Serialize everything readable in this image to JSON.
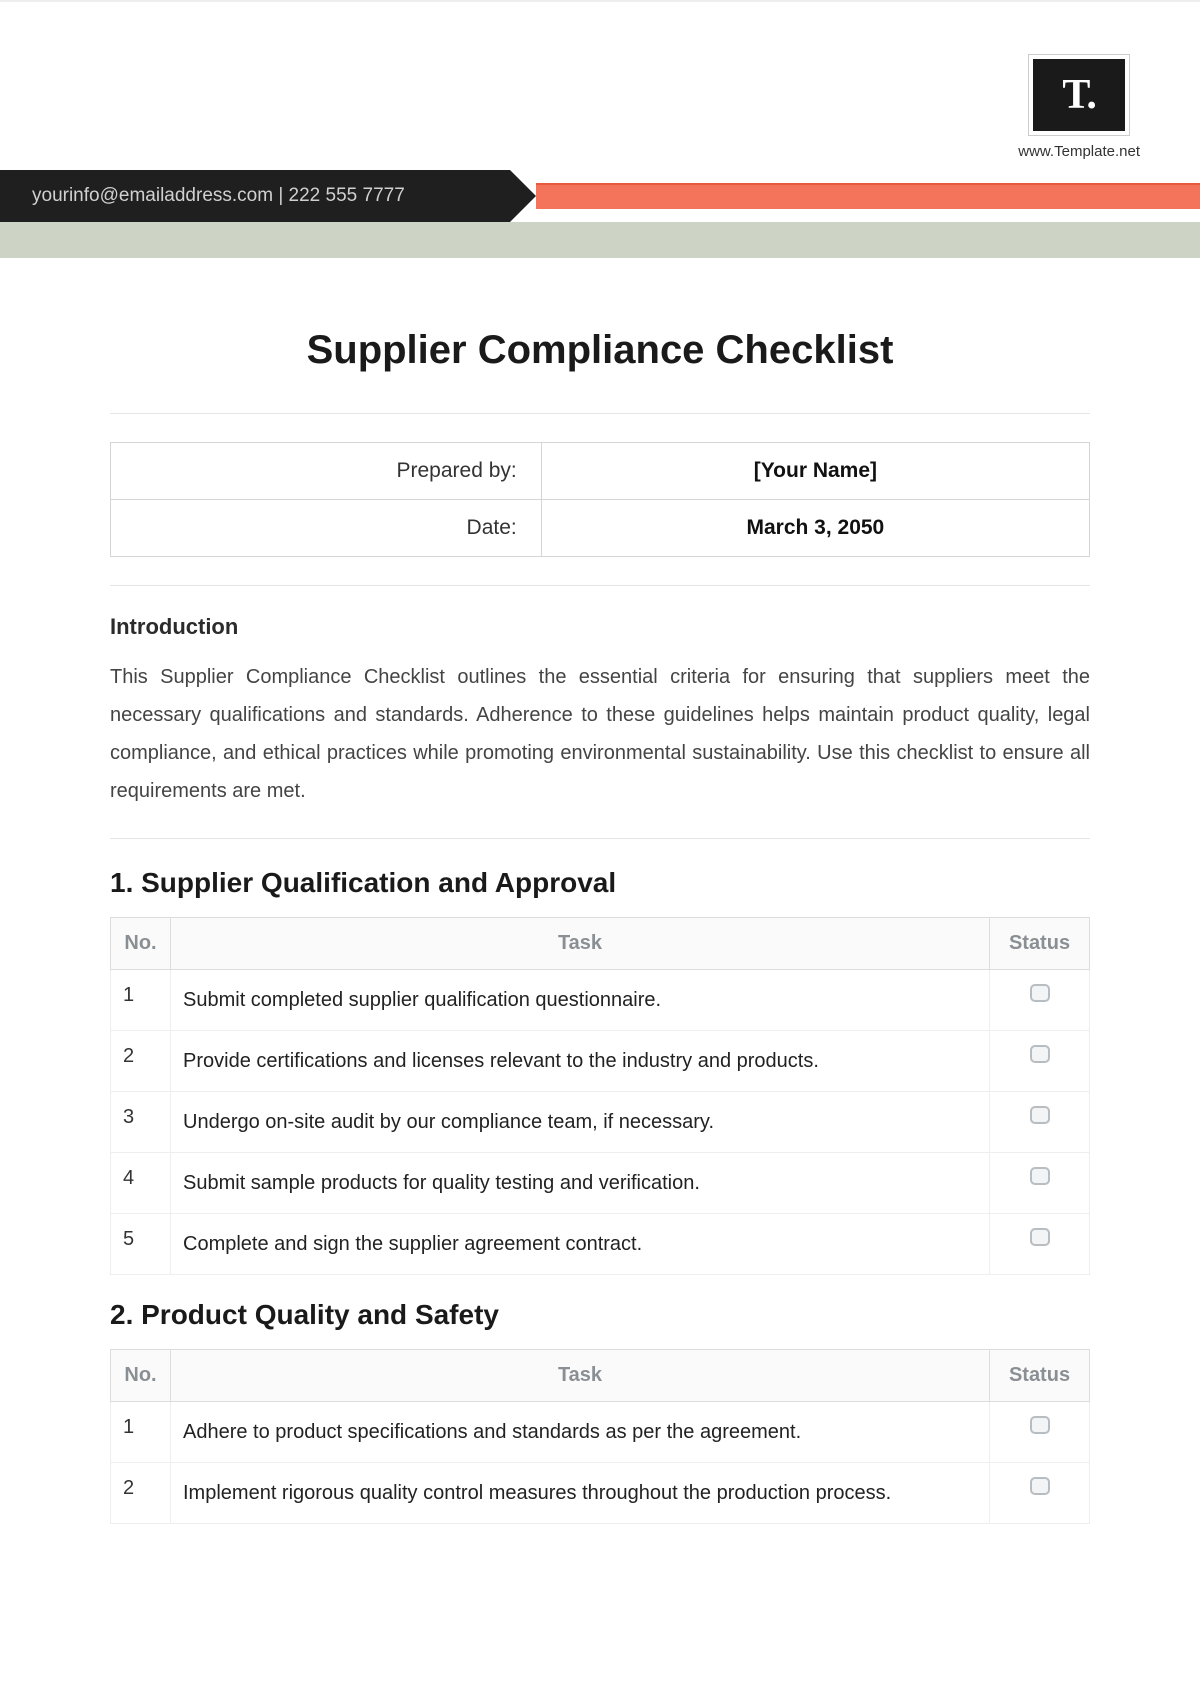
{
  "logo": {
    "letter": "T.",
    "url": "www.Template.net"
  },
  "ribbon": {
    "contact": "yourinfo@emailaddress.com | 222 555 7777"
  },
  "title": "Supplier Compliance Checklist",
  "meta": {
    "prepared_label": "Prepared by:",
    "prepared_value": "[Your Name]",
    "date_label": "Date:",
    "date_value": "March 3, 2050"
  },
  "intro": {
    "heading": "Introduction",
    "text": "This Supplier Compliance Checklist outlines the essential criteria for ensuring that suppliers meet the necessary qualifications and standards. Adherence to these guidelines helps maintain product quality, legal compliance, and ethical practices while promoting environmental sustainability. Use this checklist to ensure all requirements are met."
  },
  "columns": {
    "no": "No.",
    "task": "Task",
    "status": "Status"
  },
  "sections": [
    {
      "heading": "1. Supplier Qualification and Approval",
      "rows": [
        {
          "no": "1",
          "task": "Submit completed supplier qualification questionnaire."
        },
        {
          "no": "2",
          "task": "Provide certifications and licenses relevant to the industry and products."
        },
        {
          "no": "3",
          "task": "Undergo on-site audit by our compliance team, if necessary."
        },
        {
          "no": "4",
          "task": "Submit sample products for quality testing and verification."
        },
        {
          "no": "5",
          "task": "Complete and sign the supplier agreement contract."
        }
      ]
    },
    {
      "heading": "2. Product Quality and Safety",
      "rows": [
        {
          "no": "1",
          "task": "Adhere to product specifications and standards as per the agreement."
        },
        {
          "no": "2",
          "task": "Implement rigorous quality control measures throughout the production process."
        }
      ]
    }
  ]
}
